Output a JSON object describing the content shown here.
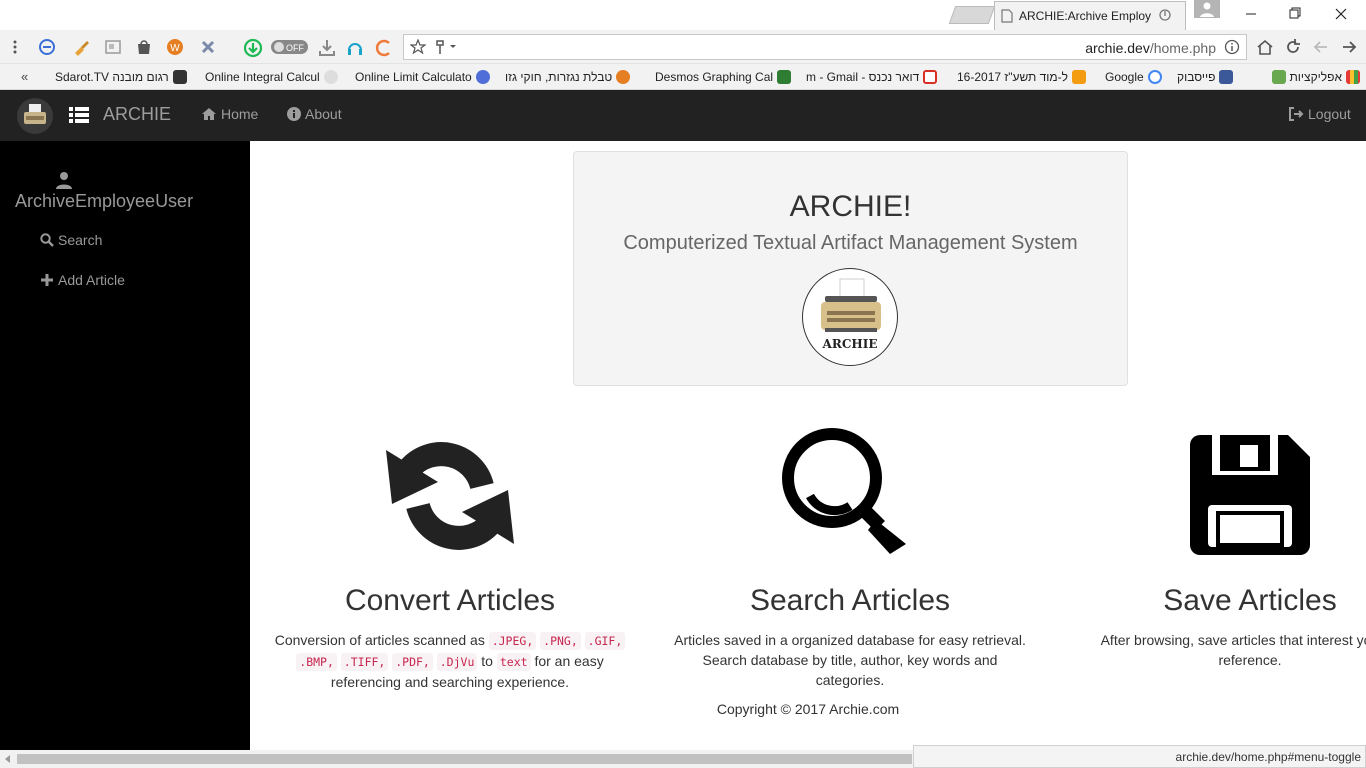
{
  "browser": {
    "tab_title": "ARCHIE:Archive Employe",
    "url_domain": "archie.dev",
    "url_path": "/home.php",
    "bookmarks": [
      {
        "label": "Sdarot.TV רגום מובנה",
        "icon": "tv-icon",
        "color": "#333333"
      },
      {
        "label": "Online Integral Calcul",
        "icon": "wolfram-icon",
        "color": "#dddddd"
      },
      {
        "label": "Online Limit Calculato",
        "icon": "limit-icon",
        "color": "#4f6ed8"
      },
      {
        "label": "טבלת נגזרות, חוקי גזו",
        "icon": "hand-icon",
        "color": "#e67e22"
      },
      {
        "label": "Desmos Graphing Cal",
        "icon": "desmos-icon",
        "color": "#2e7d32"
      },
      {
        "label": "m - Gmail - דואר נכנס",
        "icon": "gmail-icon",
        "color": "#d93025"
      },
      {
        "label": "16-2017 ל-מוד תשע\"ז",
        "icon": "moodle-icon",
        "color": "#f39c12"
      },
      {
        "label": "Google",
        "icon": "google-icon",
        "color": "#4285f4"
      },
      {
        "label": "פייסבוק",
        "icon": "facebook-icon",
        "color": "#3b5998"
      },
      {
        "label": "אפליקציות",
        "icon": "apps-icon",
        "color": "#e53935"
      }
    ]
  },
  "navbar": {
    "brand": "ARCHIE",
    "home": "Home",
    "about": "About",
    "logout": "Logout"
  },
  "sidebar": {
    "username": "ArchiveEmployeeUser",
    "items": [
      {
        "label": "Search",
        "icon": "search-icon"
      },
      {
        "label": "Add Article",
        "icon": "plus-icon"
      }
    ]
  },
  "jumbotron": {
    "title": "ARCHIE!",
    "subtitle": "Computerized Textual Artifact Management System",
    "logo_text": "ARCHIE"
  },
  "features": {
    "convert": {
      "title": "Convert Articles",
      "desc_start": "Conversion of articles scanned as",
      "formats": [
        ".JPEG,",
        ".PNG,",
        ".GIF,",
        ".BMP,",
        ".TIFF,",
        ".PDF,",
        ".DjVu"
      ],
      "desc_to": "to",
      "target": "text",
      "desc_end": "for an easy referencing and searching experience."
    },
    "search": {
      "title": "Search Articles",
      "desc": "Articles saved in a organized database for easy retrieval. Search database by title, author, key words and categories."
    },
    "save": {
      "title": "Save Articles",
      "desc": "After browsing, save articles that interest you for reference."
    }
  },
  "footer": {
    "copyright": "Copyright © 2017 Archie.com"
  },
  "status_bar": {
    "url": "archie.dev/home.php#menu-toggle"
  }
}
